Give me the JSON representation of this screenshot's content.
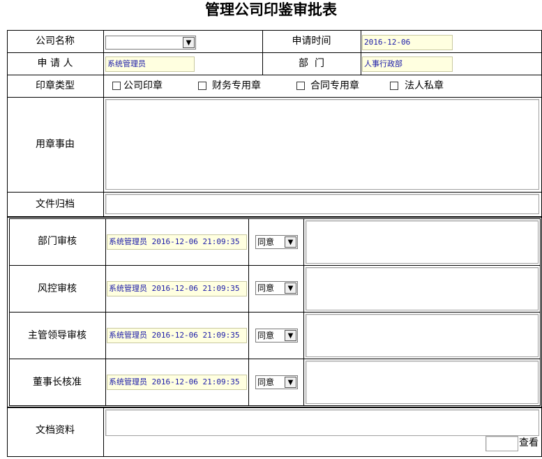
{
  "title": "管理公司印鉴审批表",
  "fields": {
    "company_label": "公司名称",
    "company_value": "",
    "apply_time_label": "申请时间",
    "apply_time_value": "2016-12-06",
    "applicant_label": "申 请 人",
    "applicant_value": "系统管理员",
    "dept_label": "部  门",
    "dept_value": "人事行政部",
    "seal_type_label": "印章类型",
    "seal_types": [
      "公司印章",
      "财务专用章",
      "合同专用章",
      "法人私章"
    ],
    "reason_label": "用章事由",
    "archive_label": "文件归档",
    "docs_label": "文档资料",
    "view_label": "查看"
  },
  "approvals": [
    {
      "label": "部门审核",
      "stamp": "系统管理员 2016-12-06 21:09:35",
      "decision": "同意"
    },
    {
      "label": "风控审核",
      "stamp": "系统管理员 2016-12-06 21:09:35",
      "decision": "同意"
    },
    {
      "label": "主管领导审核",
      "stamp": "系统管理员 2016-12-06 21:09:35",
      "decision": "同意"
    },
    {
      "label": "董事长核准",
      "stamp": "系统管理员 2016-12-06 21:09:35",
      "decision": "同意"
    }
  ],
  "colors": {
    "field_bg": "#ffffe0",
    "field_text": "#1a1aa8",
    "border": "#000000"
  }
}
